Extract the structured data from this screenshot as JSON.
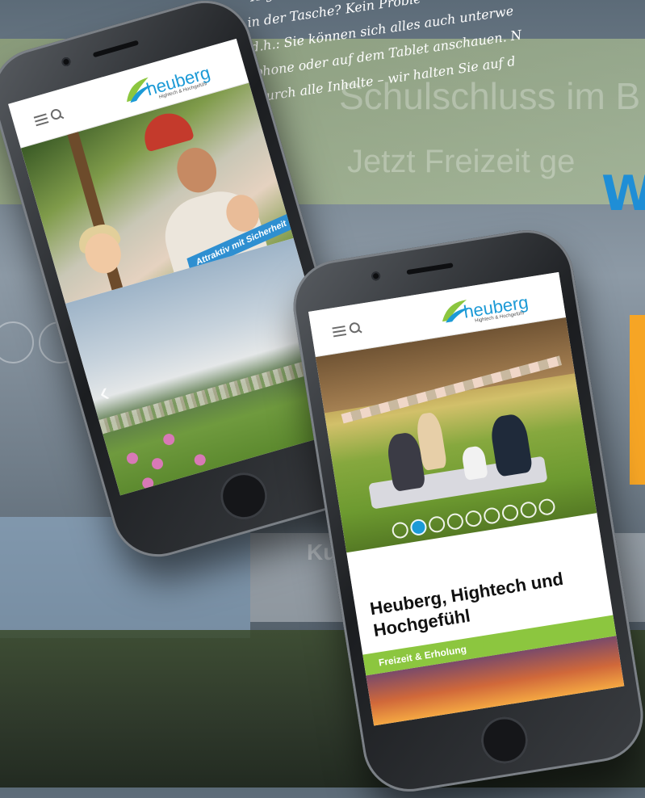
{
  "intro_text": {
    "lines": [
      "\"Highte",
      "in der Tasche? Kein Proble",
      "d.h.: Sie können sich alles auch unterwe",
      "phone oder auf dem Tablet anschauen. N",
      "durch alle Inhalte – wir halten Sie auf d"
    ]
  },
  "background": {
    "banner_line_1": "Schulschluss im B",
    "banner_line_2": "Jetzt Freizeit ge",
    "letter_w": "W",
    "band_text": "Ku                    ng",
    "colors": {
      "accent_blue": "#1f8ed6",
      "accent_orange": "#f6a525"
    }
  },
  "site": {
    "logo_word": "heuberg",
    "logo_tagline": "Hightech & Hochgefühl",
    "brand_blue": "#1c9ad6",
    "brand_green": "#8cc63f",
    "icons": [
      "menu-icon",
      "search-icon"
    ]
  },
  "phone1": {
    "badge": "Attraktiv mit Sicherheit",
    "prev_glyph": "‹",
    "next_glyph": "›"
  },
  "phone2": {
    "title": "Heuberg, Hightech und Hochgefühl",
    "category": "Freizeit & Erholung",
    "slider_count": 9,
    "slider_active_index": 1
  }
}
